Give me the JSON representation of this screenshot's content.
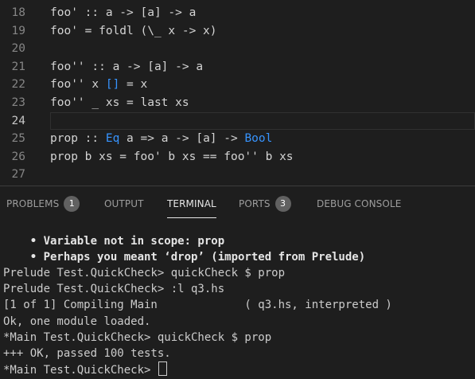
{
  "editor": {
    "lines": [
      {
        "num": "18",
        "segments": [
          {
            "t": "foo' :: a -> [a] -> a",
            "c": "plain"
          }
        ]
      },
      {
        "num": "19",
        "segments": [
          {
            "t": "foo' = foldl (\\_ x -> x)",
            "c": "plain"
          }
        ]
      },
      {
        "num": "20",
        "segments": []
      },
      {
        "num": "21",
        "segments": [
          {
            "t": "foo'' :: a -> [a] -> a",
            "c": "plain"
          }
        ]
      },
      {
        "num": "22",
        "segments": [
          {
            "t": "foo'' x ",
            "c": "plain"
          },
          {
            "t": "[]",
            "c": "type"
          },
          {
            "t": " = x",
            "c": "plain"
          }
        ]
      },
      {
        "num": "23",
        "segments": [
          {
            "t": "foo'' _ xs = last xs",
            "c": "plain"
          }
        ]
      },
      {
        "num": "24",
        "segments": [],
        "current": true
      },
      {
        "num": "25",
        "segments": [
          {
            "t": "prop :: ",
            "c": "plain"
          },
          {
            "t": "Eq",
            "c": "type"
          },
          {
            "t": " a => a -> [a] -> ",
            "c": "plain"
          },
          {
            "t": "Bool",
            "c": "type"
          }
        ]
      },
      {
        "num": "26",
        "segments": [
          {
            "t": "prop b xs = foo' b xs == foo'' b xs",
            "c": "plain"
          }
        ]
      },
      {
        "num": "27",
        "segments": []
      }
    ]
  },
  "panel": {
    "tabs": [
      {
        "label": "PROBLEMS",
        "badge": "1",
        "active": false
      },
      {
        "label": "OUTPUT",
        "badge": null,
        "active": false
      },
      {
        "label": "TERMINAL",
        "badge": null,
        "active": true
      },
      {
        "label": "PORTS",
        "badge": "3",
        "active": false
      },
      {
        "label": "DEBUG CONSOLE",
        "badge": null,
        "active": false
      }
    ]
  },
  "terminal": {
    "lines": [
      {
        "text": "    • Variable not in scope: prop",
        "bold": true
      },
      {
        "text": "    • Perhaps you meant ‘drop’ (imported from Prelude)",
        "bold": true
      },
      {
        "text": "Prelude Test.QuickCheck> quickCheck $ prop",
        "bold": false
      },
      {
        "text": "Prelude Test.QuickCheck> :l q3.hs",
        "bold": false
      },
      {
        "text": "[1 of 1] Compiling Main             ( q3.hs, interpreted )",
        "bold": false
      },
      {
        "text": "Ok, one module loaded.",
        "bold": false
      },
      {
        "text": "*Main Test.QuickCheck> quickCheck $ prop",
        "bold": false
      },
      {
        "text": "+++ OK, passed 100 tests.",
        "bold": false
      },
      {
        "text": "*Main Test.QuickCheck> ",
        "bold": false,
        "cursor": true
      }
    ]
  },
  "colors": {
    "background": "#1e1e1e",
    "keyword_type": "#3794ff",
    "text": "#d4d4d4",
    "badge": "#616161"
  }
}
